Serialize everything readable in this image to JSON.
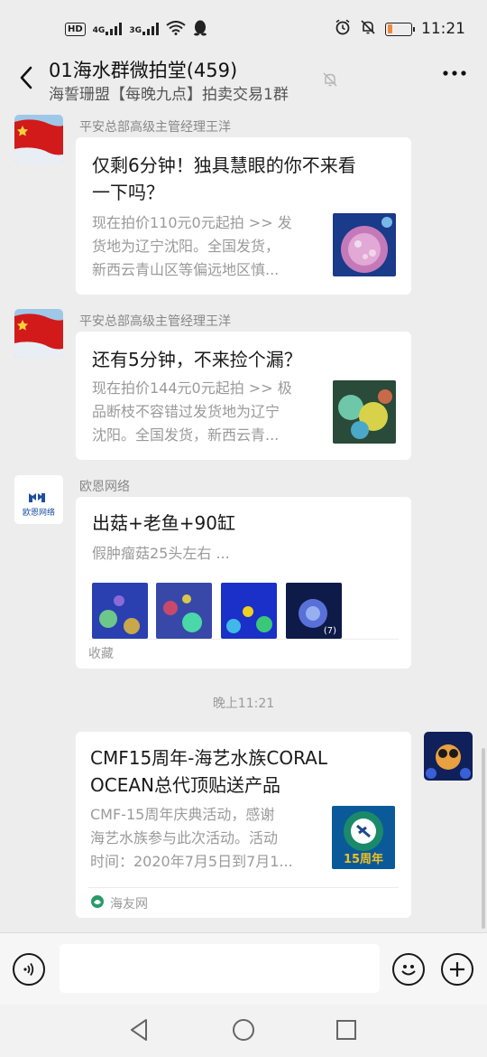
{
  "status_bar": {
    "network_left": "HD",
    "sig1": "4G",
    "sig2": "3G",
    "time": "11:21",
    "battery_level": 0.2
  },
  "header": {
    "title": "01海水群微拍堂(459)",
    "subtitle": "海誓珊盟【每晚九点】拍卖交易1群",
    "back_icon": "chevron-left-icon",
    "mute_icon": "bell-off-icon",
    "more_icon": "more-icon"
  },
  "messages": [
    {
      "sender": "平安总部高级主管经理王洋",
      "title_line1": "仅剩6分钟！独具慧眼的你不来看",
      "title_line2": "一下吗？",
      "desc_line1": "现在拍价110元0元起拍 >> 发",
      "desc_line2": "货地为辽宁沈阳。全国发货，",
      "desc_line3": "新西云青山区等偏远地区慎..."
    },
    {
      "sender": "平安总部高级主管经理王洋",
      "title_line1": "还有5分钟，不来捡个漏？",
      "desc_line1": "现在拍价144元0元起拍 >> 极",
      "desc_line2": "品断枝不容错过发货地为辽宁",
      "desc_line3": "沈阳。全国发货，新西云青..."
    },
    {
      "sender": "欧恩网络",
      "avatar_text": "欧恩网络",
      "title_line1": "出菇+老鱼+90缸",
      "desc_line1": "假肿瘤菇25头左右 ...",
      "image_count": "(7)",
      "footer": "收藏"
    }
  ],
  "timestamp": "晚上11:21",
  "own_message": {
    "title_line1": "CMF15周年-海艺水族CORAL",
    "title_line2": "OCEAN总代顶贴送产品",
    "desc_line1": "CMF-15周年庆典活动，感谢",
    "desc_line2": "海艺水族参与此次活动。活动",
    "desc_line3": "时间：2020年7月5日到7月1...",
    "thumb_text": "15周年",
    "source": "海友网"
  },
  "input_bar": {
    "voice_icon": "voice-icon",
    "emoji_icon": "emoji-icon",
    "plus_icon": "plus-icon"
  },
  "nav_bar": {
    "back_icon": "nav-back-icon",
    "home_icon": "nav-home-icon",
    "recents_icon": "nav-recents-icon"
  },
  "colors": {
    "background": "#ededed",
    "card": "#ffffff",
    "muted_text": "#9a9a9a",
    "battery": "#f08a3a"
  }
}
